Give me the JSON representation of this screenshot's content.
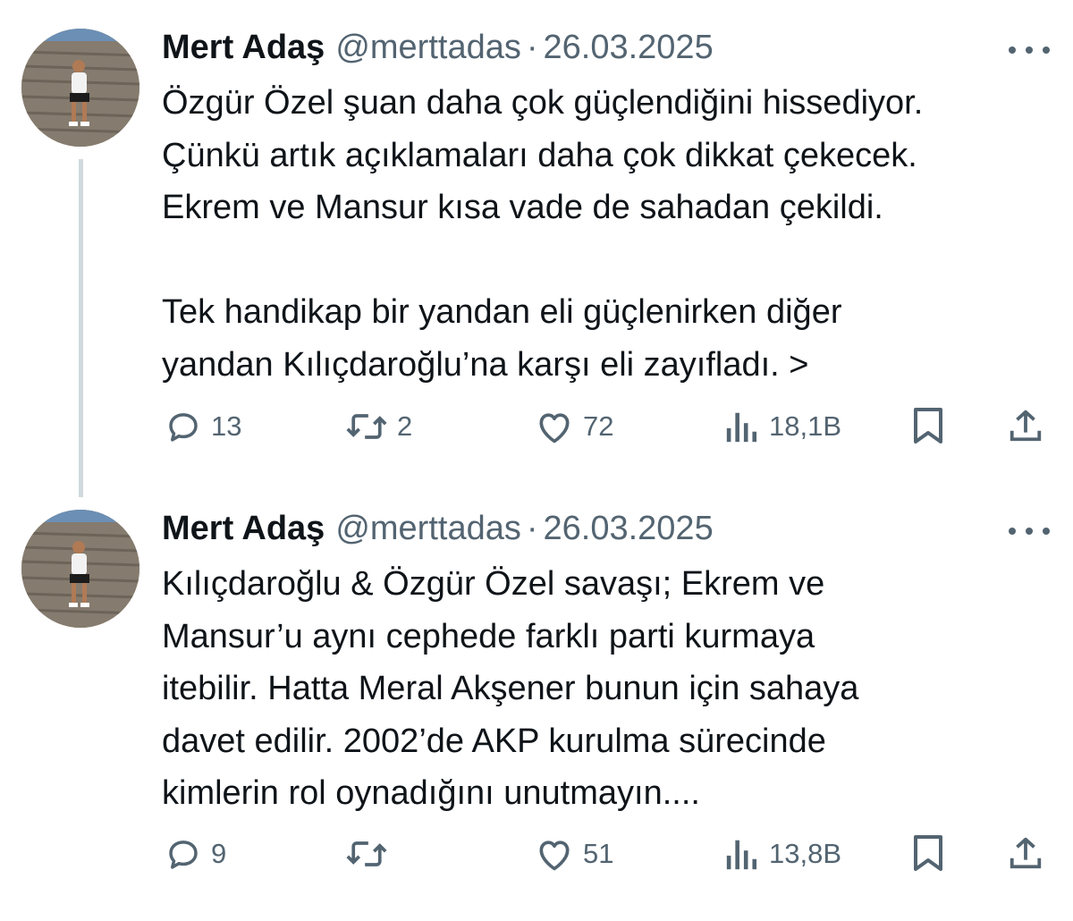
{
  "tweets": [
    {
      "author": {
        "name": "Mert Adaş",
        "handle": "@merttadas"
      },
      "date": "26.03.2025",
      "separator": "·",
      "lines": [
        "Özgür Özel şuan daha çok güçlendiğini hissediyor.",
        "Çünkü artık açıklamaları daha çok dikkat çekecek.",
        "Ekrem ve Mansur kısa vade de sahadan çekildi.",
        "",
        "Tek handikap bir yandan eli güçlenirken diğer",
        "yandan Kılıçdaroğlu’na karşı eli zayıfladı. >"
      ],
      "stats": {
        "replies": "13",
        "reposts": "2",
        "likes": "72",
        "views": "18,1B"
      }
    },
    {
      "author": {
        "name": "Mert Adaş",
        "handle": "@merttadas"
      },
      "date": "26.03.2025",
      "separator": "·",
      "lines": [
        "Kılıçdaroğlu & Özgür Özel savaşı; Ekrem ve",
        "Mansur’u aynı cephede farklı parti kurmaya",
        "itebilir. Hatta Meral Akşener bunun için sahaya",
        "davet edilir. 2002’de AKP kurulma sürecinde",
        "kimlerin rol oynadığını unutmayın...."
      ],
      "stats": {
        "replies": "9",
        "reposts": "",
        "likes": "51",
        "views": "13,8B"
      }
    }
  ],
  "icons": {
    "reply": "speech-bubble-icon",
    "repost": "repost-arrows-icon",
    "like": "heart-icon",
    "views": "bar-chart-icon",
    "bookmark": "bookmark-icon",
    "share": "share-upload-icon",
    "more": "three-dots-icon"
  },
  "colors": {
    "text": "#0f1419",
    "secondary": "#536471",
    "thread_line": "#cfd9de"
  }
}
